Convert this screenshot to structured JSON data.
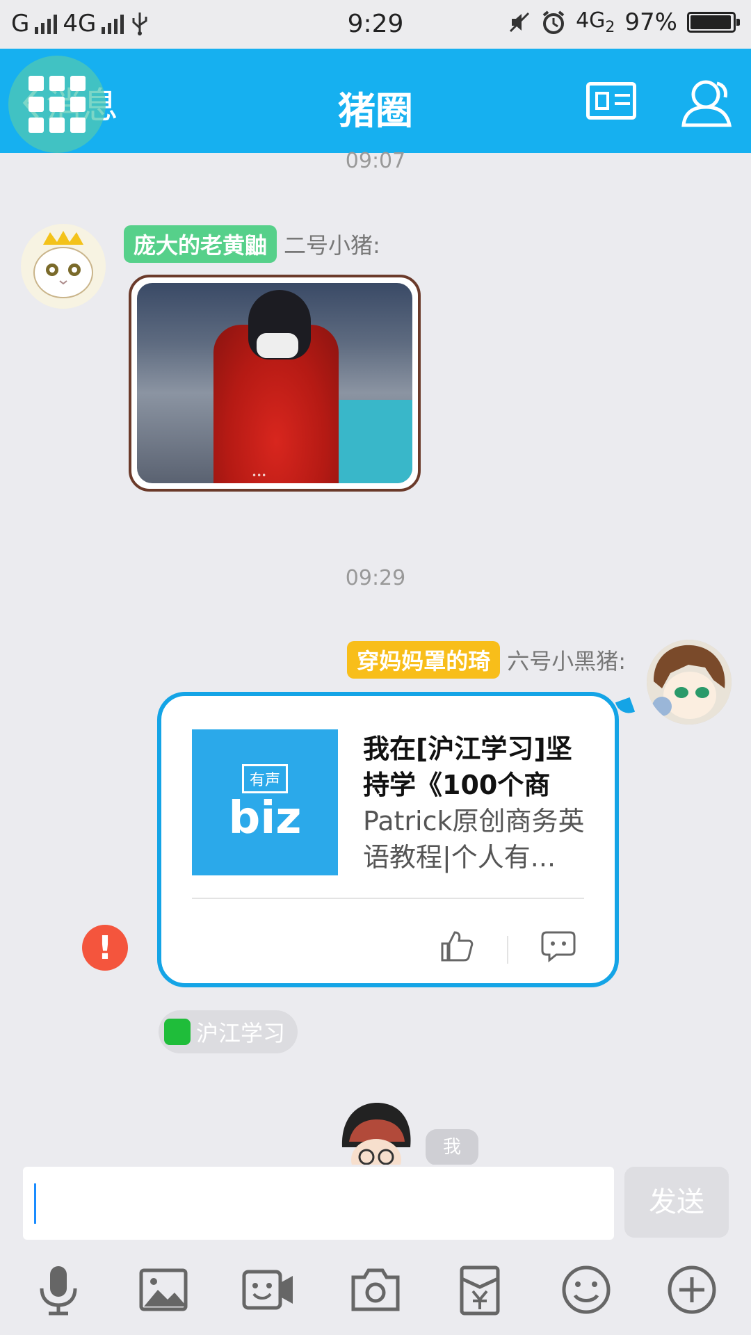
{
  "status_bar": {
    "carrier_left": "G",
    "network": "4G",
    "time": "9:29",
    "network_right": "4G",
    "network_right_sub": "2",
    "battery": "97%",
    "battery_level": 0.97
  },
  "header": {
    "back_label": "消息",
    "title": "猪圈"
  },
  "messages": [
    {
      "timestamp": "09:07",
      "tag": "庞大的老黄鼬",
      "tag_color": "#56d08a",
      "sender": "二号小猪:",
      "type": "image",
      "image_caption": "•••"
    },
    {
      "timestamp": "09:29",
      "tag": "穿妈妈罩的琦",
      "tag_color": "#f8be1a",
      "sender": "六号小黑猪:",
      "type": "link",
      "thumb_badge": "有声",
      "thumb_text": "biz",
      "card_title": "我在[沪江学习]坚持学《100个商",
      "card_desc": "Patrick原创商务英语教程|个人有...",
      "source": "沪江学习",
      "error": "!"
    },
    {
      "type": "self",
      "label": "我"
    }
  ],
  "input": {
    "value": "",
    "send_label": "发送"
  },
  "toolbar": [
    "microphone-icon",
    "image-icon",
    "video-icon",
    "camera-icon",
    "red-packet-icon",
    "emoji-icon",
    "plus-icon"
  ],
  "colors": {
    "header": "#16b0f0",
    "card_border": "#14a4e6",
    "error": "#f4553d"
  }
}
